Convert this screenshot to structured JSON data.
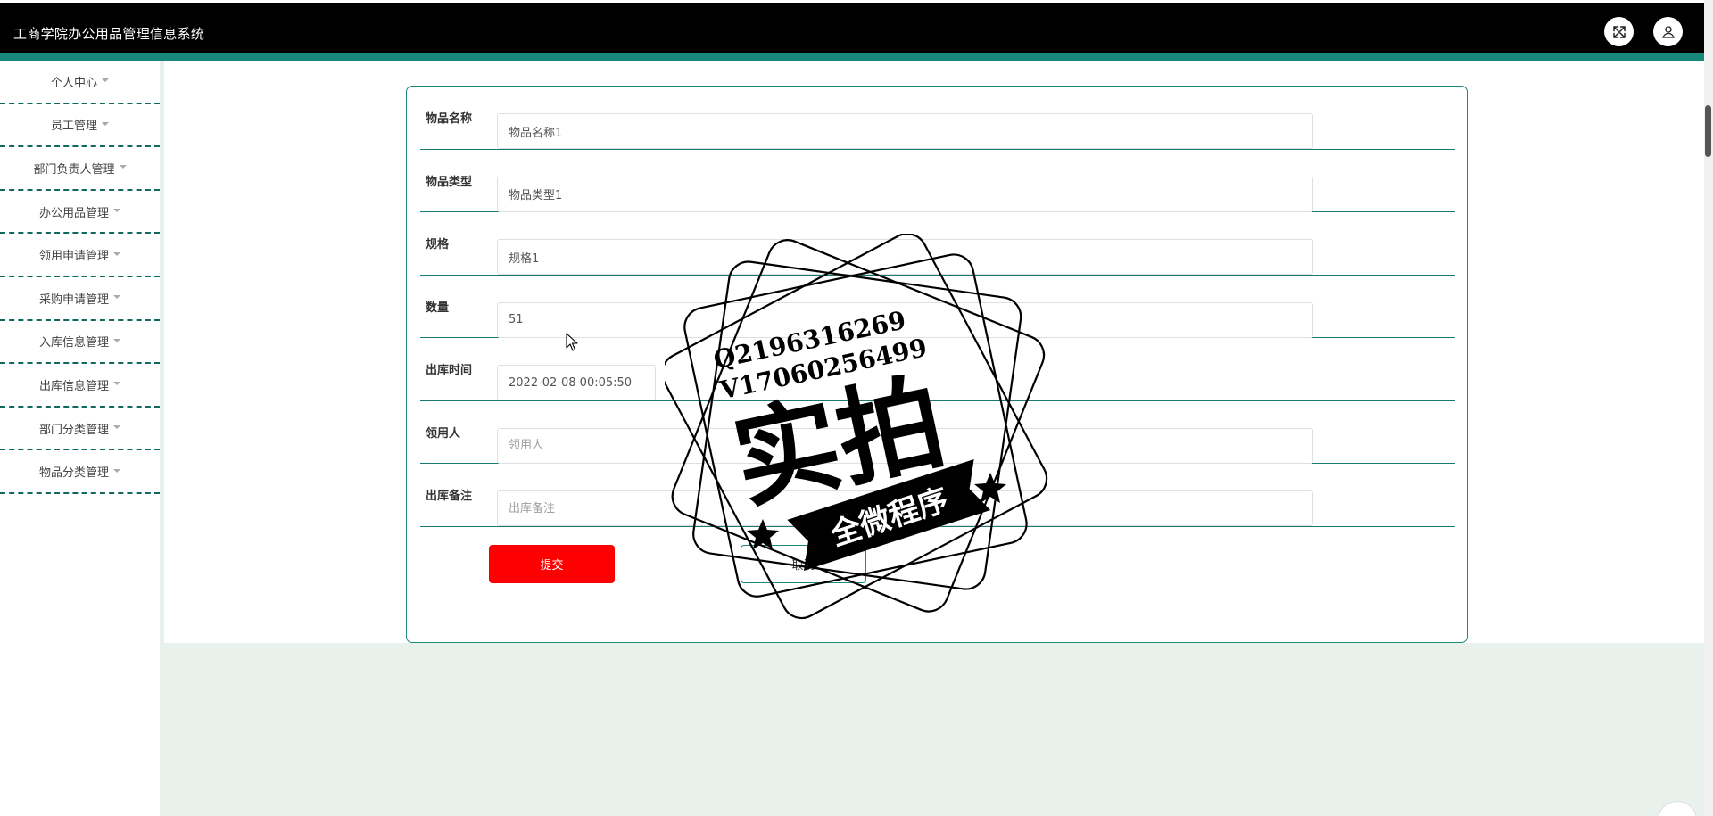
{
  "header": {
    "title": "工商学院办公用品管理信息系统",
    "fullscreen_icon": "expand-icon",
    "user_icon": "user-icon"
  },
  "sidebar": {
    "items": [
      {
        "label": "个人中心"
      },
      {
        "label": "员工管理"
      },
      {
        "label": "部门负责人管理"
      },
      {
        "label": "办公用品管理"
      },
      {
        "label": "领用申请管理"
      },
      {
        "label": "采购申请管理"
      },
      {
        "label": "入库信息管理"
      },
      {
        "label": "出库信息管理"
      },
      {
        "label": "部门分类管理"
      },
      {
        "label": "物品分类管理"
      }
    ]
  },
  "form": {
    "fields": [
      {
        "label": "物品名称",
        "value": "物品名称1",
        "placeholder": "物品名称"
      },
      {
        "label": "物品类型",
        "value": "物品类型1",
        "placeholder": "物品类型"
      },
      {
        "label": "规格",
        "value": "规格1",
        "placeholder": "规格"
      },
      {
        "label": "数量",
        "value": "51",
        "placeholder": "数量"
      },
      {
        "label": "出库时间",
        "value": "2022-02-08 00:05:50",
        "placeholder": "出库时间"
      },
      {
        "label": "领用人",
        "value": "",
        "placeholder": "领用人"
      },
      {
        "label": "出库备注",
        "value": "",
        "placeholder": "出库备注"
      }
    ],
    "submit_label": "提交",
    "cancel_label": "取消"
  },
  "watermark": {
    "line1": "Q2196316269",
    "line2": "V17060256499",
    "main": "实拍",
    "banner": "全微程序"
  }
}
